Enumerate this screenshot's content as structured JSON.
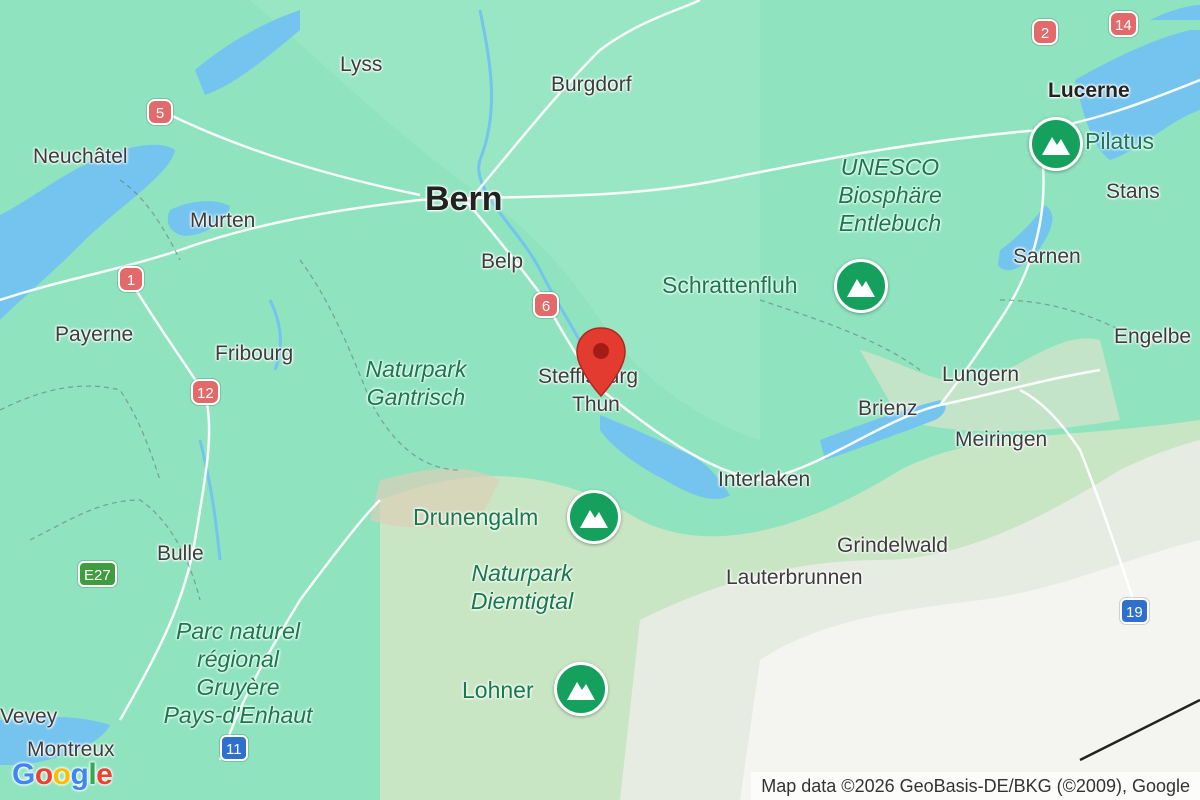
{
  "map": {
    "cities": [
      {
        "id": "lyss",
        "label": "Lyss",
        "style": "city"
      },
      {
        "id": "burgdorf",
        "label": "Burgdorf",
        "style": "city"
      },
      {
        "id": "lucerne",
        "label": "Lucerne",
        "style": "bold"
      },
      {
        "id": "neuchatel",
        "label": "Neuchâtel",
        "style": "city"
      },
      {
        "id": "bern",
        "label": "Bern",
        "style": "capital"
      },
      {
        "id": "murten",
        "label": "Murten",
        "style": "city"
      },
      {
        "id": "stans",
        "label": "Stans",
        "style": "city"
      },
      {
        "id": "belp",
        "label": "Belp",
        "style": "city"
      },
      {
        "id": "sarnen",
        "label": "Sarnen",
        "style": "city"
      },
      {
        "id": "payerne",
        "label": "Payerne",
        "style": "city"
      },
      {
        "id": "fribourg",
        "label": "Fribourg",
        "style": "city"
      },
      {
        "id": "engelberg",
        "label": "Engelbe",
        "style": "city"
      },
      {
        "id": "steffisburg",
        "label": "Steffisburg",
        "style": "city"
      },
      {
        "id": "lungern",
        "label": "Lungern",
        "style": "city"
      },
      {
        "id": "thun",
        "label": "Thun",
        "style": "city"
      },
      {
        "id": "brienz",
        "label": "Brienz",
        "style": "city"
      },
      {
        "id": "meiringen",
        "label": "Meiringen",
        "style": "city"
      },
      {
        "id": "interlaken",
        "label": "Interlaken",
        "style": "city"
      },
      {
        "id": "grindelwald",
        "label": "Grindelwald",
        "style": "city"
      },
      {
        "id": "bulle",
        "label": "Bulle",
        "style": "city"
      },
      {
        "id": "lauterbrunnen",
        "label": "Lauterbrunnen",
        "style": "city"
      },
      {
        "id": "vevey",
        "label": "Vevey",
        "style": "city"
      },
      {
        "id": "montreux",
        "label": "Montreux",
        "style": "city"
      }
    ],
    "parks": {
      "unesco": "UNESCO\nBiosphäre\nEntlebuch",
      "gantrisch": "Naturpark\nGantrisch",
      "diemtigtal": "Naturpark\nDiemtigtal",
      "gruyere": "Parc naturel\nrégional\nGruyère\nPays-d'Enhaut"
    },
    "peaks": [
      {
        "id": "pilatus",
        "label": "Pilatus"
      },
      {
        "id": "schrattenfluh",
        "label": "Schrattenfluh"
      },
      {
        "id": "drunengalm",
        "label": "Drunengalm"
      },
      {
        "id": "lohner",
        "label": "Lohner"
      }
    ],
    "shields": [
      {
        "id": "r2",
        "label": "2",
        "kind": "red"
      },
      {
        "id": "r14",
        "label": "14",
        "kind": "red"
      },
      {
        "id": "r5",
        "label": "5",
        "kind": "red"
      },
      {
        "id": "r1",
        "label": "1",
        "kind": "red"
      },
      {
        "id": "r6",
        "label": "6",
        "kind": "red"
      },
      {
        "id": "r12",
        "label": "12",
        "kind": "red"
      },
      {
        "id": "e27",
        "label": "E27",
        "kind": "green"
      },
      {
        "id": "r19",
        "label": "19",
        "kind": "blue"
      },
      {
        "id": "r11",
        "label": "11",
        "kind": "blue"
      }
    ]
  },
  "logo": {
    "text": "Google"
  },
  "attribution": "Map data ©2026 GeoBasis-DE/BKG (©2009), Google",
  "colors": {
    "land": "#8fe3bf",
    "water": "#74c4ef",
    "marker": "#e33b2f",
    "park_pin": "#16a05e"
  }
}
